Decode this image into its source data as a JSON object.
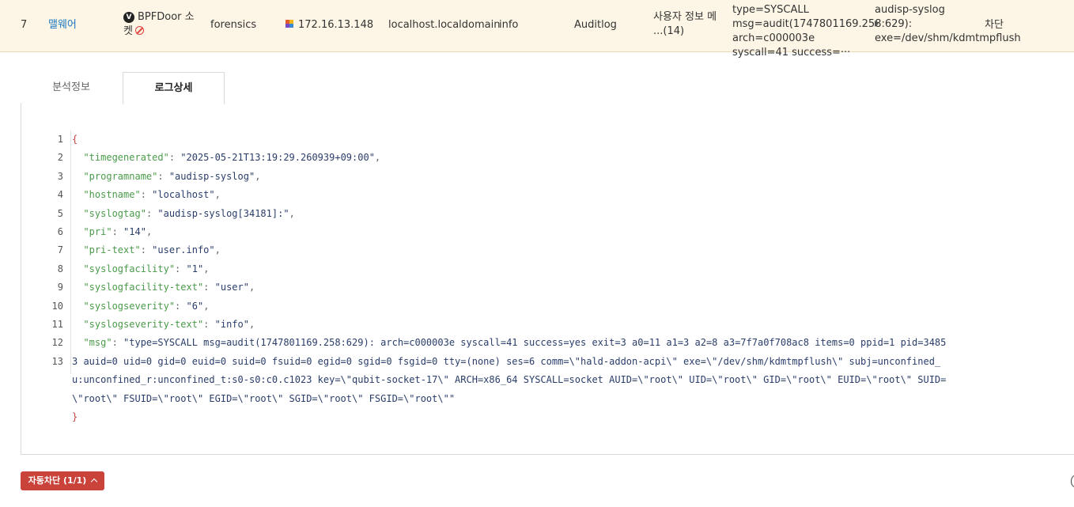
{
  "row": {
    "number": "7",
    "category": "맬웨어",
    "detection_badge": "V",
    "detection_name": "BPFDoor 소켓",
    "team": "forensics",
    "ip": "172.16.13.148",
    "hostname": "localhost.localdomain",
    "level": "info",
    "log_type": "Auditlog",
    "event": "사용자 정보 메 ...(14)",
    "message": "type=SYSCALL msg=audit(1747801169.258:629): arch=c000003e syscall=41 success=···",
    "program": "audisp-syslog",
    "exe": "exe=/dev/shm/kdmtmpflush",
    "action": "차단"
  },
  "tabs": [
    {
      "label": "분석정보"
    },
    {
      "label": "로그상세"
    }
  ],
  "log_detail": {
    "line_numbers": [
      "1",
      "2",
      "3",
      "4",
      "5",
      "6",
      "7",
      "8",
      "9",
      "10",
      "11",
      "12",
      "13"
    ],
    "open_brace": "{",
    "close_brace": "}",
    "fields": [
      {
        "key": "\"timegenerated\"",
        "value": "\"2025-05-21T13:19:29.260939+09:00\""
      },
      {
        "key": "\"programname\"",
        "value": "\"audisp-syslog\""
      },
      {
        "key": "\"hostname\"",
        "value": "\"localhost\""
      },
      {
        "key": "\"syslogtag\"",
        "value": "\"audisp-syslog[34181]:\""
      },
      {
        "key": "\"pri\"",
        "value": "\"14\""
      },
      {
        "key": "\"pri-text\"",
        "value": "\"user.info\""
      },
      {
        "key": "\"syslogfacility\"",
        "value": "\"1\""
      },
      {
        "key": "\"syslogfacility-text\"",
        "value": "\"user\""
      },
      {
        "key": "\"syslogseverity\"",
        "value": "\"6\""
      },
      {
        "key": "\"syslogseverity-text\"",
        "value": "\"info\""
      },
      {
        "key": "\"msg\"",
        "value": "\"type=SYSCALL msg=audit(1747801169.258:629): arch=c000003e syscall=41 success=yes exit=3 a0=11 a1=3 a2=8 a3=7f7a0f708ac8 items=0 ppid=1 pid=34853 auid=0 uid=0 gid=0 euid=0 suid=0 fsuid=0 egid=0 sgid=0 fsgid=0 tty=(none) ses=6 comm=\\\"hald-addon-acpi\\\" exe=\\\"/dev/shm/kdmtmpflush\\\" subj=unconfined_u:unconfined_r:unconfined_t:s0-s0:c0.c1023 key=\\\"qubit-socket-17\\\" ARCH=x86_64 SYSCALL=socket AUID=\\\"root\\\" UID=\\\"root\\\" GID=\\\"root\\\" EUID=\\\"root\\\" SUID=\\\"root\\\" FSUID=\\\"root\\\" EGID=\\\"root\\\" SGID=\\\"root\\\" FSGID=\\\"root\\\"\""
      }
    ]
  },
  "auto_block_button": "자동차단 (1/1)",
  "colors": {
    "row_bg": "#fdf6e6",
    "category_link": "#1a78c2",
    "json_key": "#4a9b4a",
    "json_brace": "#c0473f",
    "button_bg": "#c9433b"
  },
  "icons": {
    "badge": "v-badge-icon",
    "ban": "ban-icon",
    "pin": "pin-icon",
    "expand": "caret-right-icon",
    "collapse": "chevron-up-icon"
  }
}
